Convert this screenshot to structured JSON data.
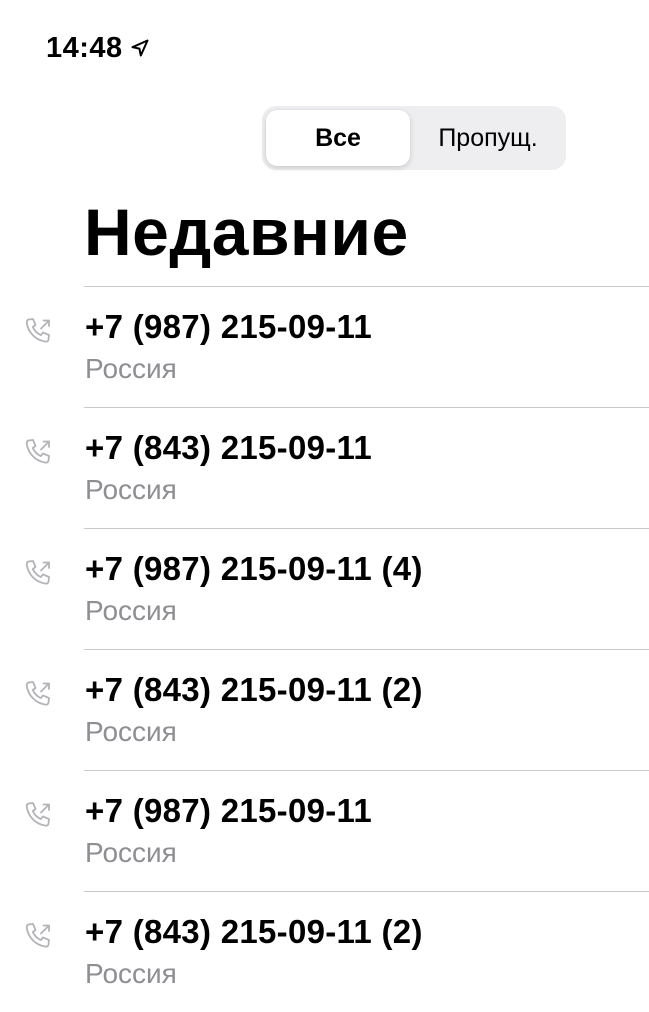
{
  "status_bar": {
    "time": "14:48",
    "location_icon": "location-arrow-icon"
  },
  "segmented_control": {
    "options": [
      "Все",
      "Пропущ."
    ],
    "selected": "Все"
  },
  "title": "Недавние",
  "row_icon": "outgoing-call-icon",
  "calls": [
    {
      "number": "+7 (987) 215-09-11",
      "location": "Россия"
    },
    {
      "number": "+7 (843) 215-09-11",
      "location": "Россия"
    },
    {
      "number": "+7 (987) 215-09-11 (4)",
      "location": "Россия"
    },
    {
      "number": "+7 (843) 215-09-11 (2)",
      "location": "Россия"
    },
    {
      "number": "+7 (987) 215-09-11",
      "location": "Россия"
    },
    {
      "number": "+7 (843) 215-09-11 (2)",
      "location": "Россия"
    }
  ],
  "colors": {
    "icon_gray": "#b3b3b8",
    "secondary_text": "#8e8e93",
    "separator": "#c9c9cc",
    "segment_bg": "#eeeef0"
  }
}
